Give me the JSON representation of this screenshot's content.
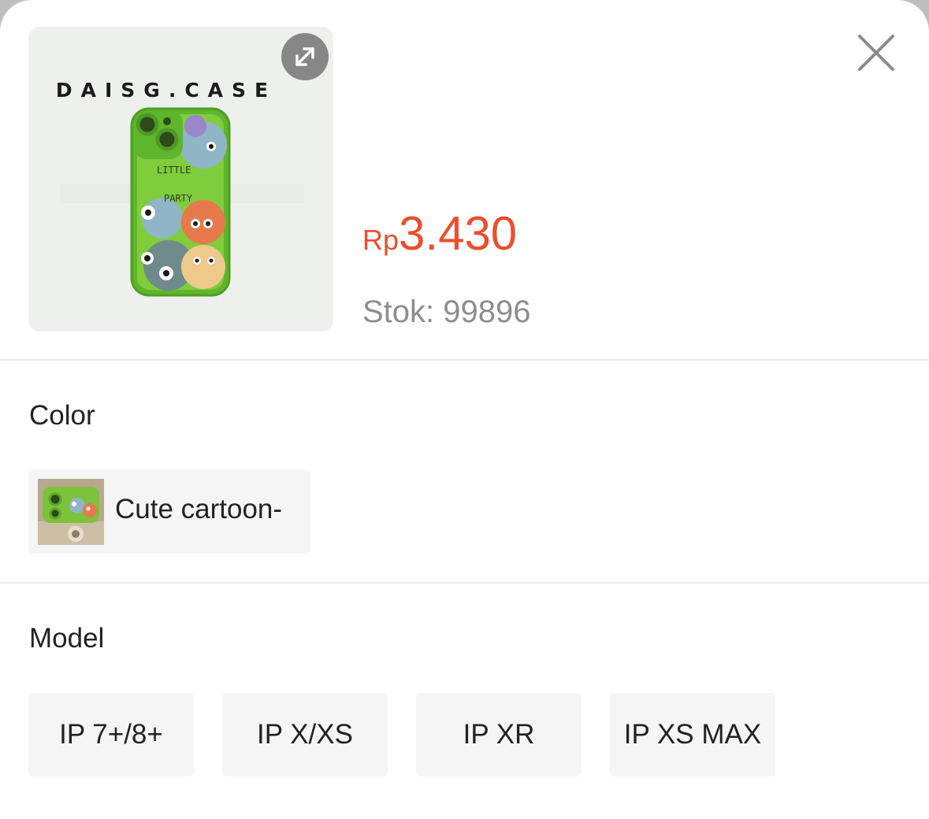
{
  "product": {
    "brand_text": "DAISG.CASE",
    "case_text_line1": "LITTLE",
    "case_text_line2": "PARTY",
    "price_currency": "Rp",
    "price_value": "3.430",
    "stock_text": "Stok: 99896"
  },
  "colors": {
    "accent": "#ee4d2d",
    "case_green": "#69c12a"
  },
  "icons": {
    "expand": "expand-arrows-icon",
    "close": "close-icon"
  },
  "sections": {
    "color_title": "Color",
    "color_options": [
      {
        "label": "Cute cartoon-"
      }
    ],
    "model_title": "Model",
    "model_options": [
      {
        "label": "IP 7+/8+"
      },
      {
        "label": "IP X/XS"
      },
      {
        "label": "IP XR"
      },
      {
        "label": "IP XS MAX"
      }
    ]
  }
}
